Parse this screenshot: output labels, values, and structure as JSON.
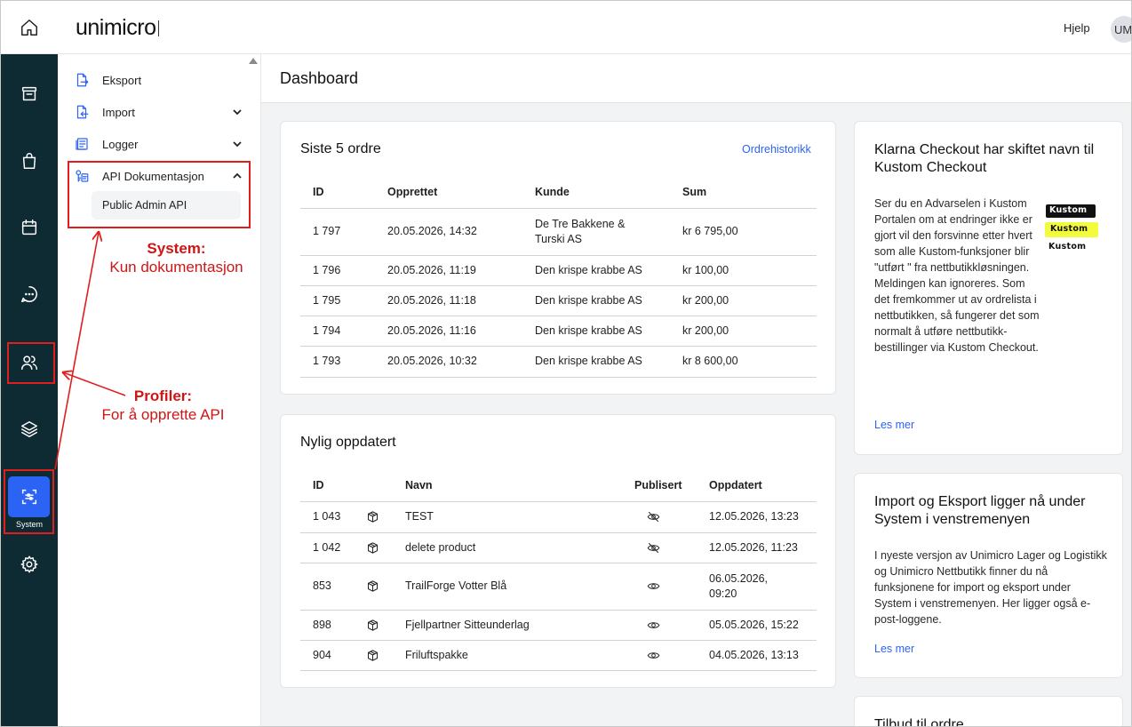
{
  "header": {
    "logo": "unimicro",
    "help_label": "Hjelp",
    "avatar_initials": "UM"
  },
  "rail": {
    "system_label": "System",
    "items": [
      "home-icon",
      "archive-icon",
      "shopping-bag-icon",
      "calendar-icon",
      "chat-icon",
      "users-icon",
      "layers-icon",
      "system-icon",
      "gear-icon"
    ]
  },
  "submenu": {
    "eksport": "Eksport",
    "import": "Import",
    "logger": "Logger",
    "api_doc": "API Dokumentasjon",
    "public_admin_api": "Public Admin API"
  },
  "page": {
    "title": "Dashboard"
  },
  "orders": {
    "title": "Siste 5 ordre",
    "link": "Ordrehistorikk",
    "columns": [
      "ID",
      "Opprettet",
      "Kunde",
      "Sum"
    ],
    "rows": [
      [
        "1 797",
        "20.05.2026, 14:32",
        "De Tre Bakkene & Turski AS",
        "kr 6 795,00"
      ],
      [
        "1 796",
        "20.05.2026, 11:19",
        "Den krispe krabbe AS",
        "kr 100,00"
      ],
      [
        "1 795",
        "20.05.2026, 11:18",
        "Den krispe krabbe AS",
        "kr 200,00"
      ],
      [
        "1 794",
        "20.05.2026, 11:16",
        "Den krispe krabbe AS",
        "kr 200,00"
      ],
      [
        "1 793",
        "20.05.2026, 10:32",
        "Den krispe krabbe AS",
        "kr 8 600,00"
      ]
    ]
  },
  "recent": {
    "title": "Nylig oppdatert",
    "columns": [
      "ID",
      "Navn",
      "Publisert",
      "Oppdatert"
    ],
    "rows": [
      [
        "1 043",
        "TEST",
        "eye-off-icon",
        "12.05.2026, 13:23"
      ],
      [
        "1 042",
        "delete product",
        "eye-off-icon",
        "12.05.2026, 11:23"
      ],
      [
        "853",
        "TrailForge Votter Blå",
        "eye-icon",
        "06.05.2026, 09:20"
      ],
      [
        "898",
        "Fjellpartner Sitteunderlag",
        "eye-icon",
        "05.05.2026, 15:22"
      ],
      [
        "904",
        "Friluftspakke",
        "eye-icon",
        "04.05.2026, 13:13"
      ]
    ]
  },
  "news": [
    {
      "title": "Klarna Checkout har skiftet navn til Kustom Checkout",
      "body": "Ser du en Advarselen i Kustom Portalen om at endringer ikke er gjort vil den forsvinne etter hvert som alle Kustom-funksjoner blir \"utført \" fra nettbutikkløsningen. Meldingen kan ignoreres. Som det fremkommer ut av ordrelista i nettbutikken, så fungerer det som normalt å utføre nettbutikk-bestillinger via Kustom Checkout.",
      "link": "Les mer",
      "logo_text": "Kustom"
    },
    {
      "title": "Import og Eksport ligger nå under System i venstremenyen",
      "body": "I nyeste versjon av Unimicro Lager og Logistikk og Unimicro Nettbutikk finner du nå funksjonene for import og eksport under System i venstremenyen. Her ligger også e-post-loggene.",
      "link": "Les mer"
    },
    {
      "title": "Tilbud til ordre"
    }
  ],
  "annotations": {
    "system_title": "System:",
    "system_sub": "Kun dokumentasjon",
    "profiler_title": "Profiler:",
    "profiler_sub": "For å opprette API"
  },
  "colors": {
    "rail_bg": "#0e2a33",
    "accent": "#2b63f5",
    "annotation": "#e21d1d"
  }
}
